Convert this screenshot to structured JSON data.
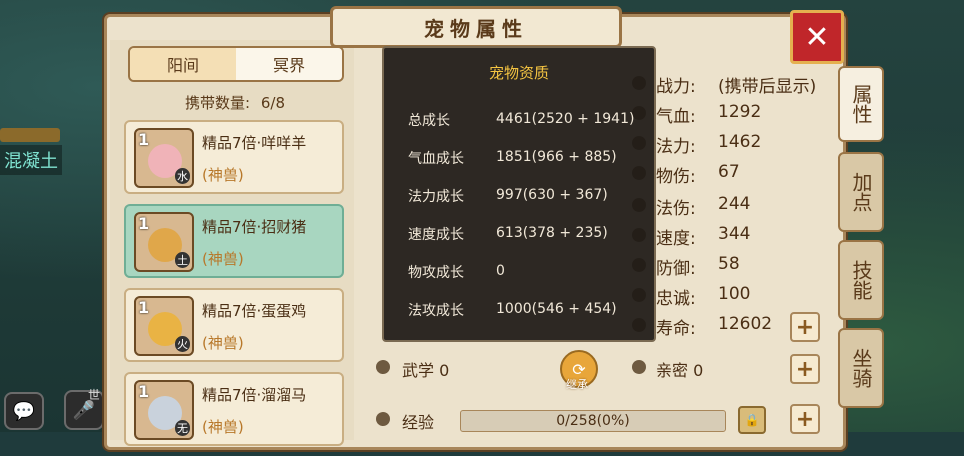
{
  "title": "宠物属性",
  "close_label": "✕",
  "world_tabs": [
    {
      "label": "阳间"
    },
    {
      "label": "冥界"
    }
  ],
  "carry": {
    "label": "携带数量:",
    "value": "6/8"
  },
  "pets": [
    {
      "level": "1",
      "name": "精品7倍·咩咩羊",
      "tag": "(神兽)",
      "element": "水"
    },
    {
      "level": "1",
      "name": "精品7倍·招财猪",
      "tag": "(神兽)",
      "element": "土"
    },
    {
      "level": "1",
      "name": "精品7倍·蛋蛋鸡",
      "tag": "(神兽)",
      "element": "火"
    },
    {
      "level": "1",
      "name": "精品7倍·溜溜马",
      "tag": "(神兽)",
      "element": "无"
    }
  ],
  "popup": {
    "title": "宠物资质",
    "rows": [
      {
        "label": "总成长",
        "value": "4461(2520 + 1941)"
      },
      {
        "label": "气血成长",
        "value": "1851(966 + 885)"
      },
      {
        "label": "法力成长",
        "value": "997(630 + 367)"
      },
      {
        "label": "速度成长",
        "value": "613(378 + 235)"
      },
      {
        "label": "物攻成长",
        "value": "0"
      },
      {
        "label": "法攻成长",
        "value": "1000(546 + 454)"
      }
    ]
  },
  "stats": [
    {
      "label": "战力:",
      "value": "(携带后显示)"
    },
    {
      "label": "气血:",
      "value": "1292"
    },
    {
      "label": "法力:",
      "value": "1462"
    },
    {
      "label": "物伤:",
      "value": "67"
    },
    {
      "label": "法伤:",
      "value": "244"
    },
    {
      "label": "速度:",
      "value": "344"
    },
    {
      "label": "防御:",
      "value": "58"
    },
    {
      "label": "忠诚:",
      "value": "100"
    },
    {
      "label": "寿命:",
      "value": "12602"
    }
  ],
  "side_tabs": [
    "属性",
    "加点",
    "技能",
    "坐骑"
  ],
  "martial": {
    "label": "武学",
    "value": "0"
  },
  "intimacy": {
    "label": "亲密",
    "value": "0"
  },
  "inherit_label": "继承",
  "exp": {
    "label": "经验",
    "value": "0/258(0%)"
  },
  "background": {
    "left_label": "混凝土",
    "mic_label": "世"
  }
}
